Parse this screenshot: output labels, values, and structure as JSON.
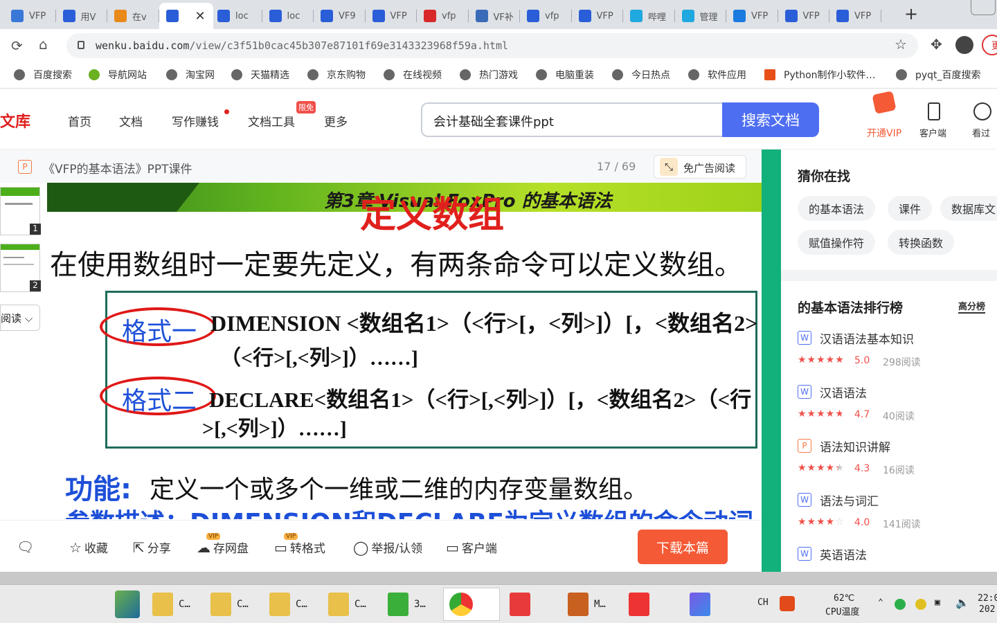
{
  "browser": {
    "tabs": [
      {
        "label": "VFP",
        "icon": "doc-icon",
        "color": "#3a78d8"
      },
      {
        "label": "用V",
        "icon": "baidu-paw-icon",
        "color": "#2a5ed8"
      },
      {
        "label": "在v",
        "icon": "chat-bubble-icon",
        "color": "#e88a1a"
      },
      {
        "label": "",
        "icon": "baidu-paw-icon",
        "color": "#2a5ed8",
        "active": true
      },
      {
        "label": "loc",
        "icon": "baidu-paw-icon",
        "color": "#2a5ed8"
      },
      {
        "label": "loc",
        "icon": "baidu-paw-icon",
        "color": "#2a5ed8"
      },
      {
        "label": "VF9",
        "icon": "baidu-paw-icon",
        "color": "#2a5ed8"
      },
      {
        "label": "VFP",
        "icon": "baidu-paw-icon",
        "color": "#2a5ed8"
      },
      {
        "label": "vfp",
        "icon": "red-v-icon",
        "color": "#d8282a"
      },
      {
        "label": "VF补",
        "icon": "tool-icon",
        "color": "#3a6ab8"
      },
      {
        "label": "vfp",
        "icon": "baidu-paw-icon",
        "color": "#2a5ed8"
      },
      {
        "label": "VFP",
        "icon": "baidu-paw-icon",
        "color": "#2a5ed8"
      },
      {
        "label": "哔哩",
        "icon": "bilibili-icon",
        "color": "#20a8e0"
      },
      {
        "label": "管理",
        "icon": "bilibili-icon",
        "color": "#20a8e0"
      },
      {
        "label": "VFP",
        "icon": "person-icon",
        "color": "#1a7ae0"
      },
      {
        "label": "VFP",
        "icon": "baidu-paw-icon",
        "color": "#2a5ed8"
      },
      {
        "label": "VFP",
        "icon": "baidu-paw-icon",
        "color": "#2a5ed8"
      }
    ],
    "url_host": "wenku.baidu.com",
    "url_path": "/view/c3f51b0cac45b307e87101f69e3143323968f59a.html",
    "profile_label": "更"
  },
  "bookmarks": [
    {
      "label": "百度搜索"
    },
    {
      "label": "导航网站"
    },
    {
      "label": "淘宝网"
    },
    {
      "label": "天猫精选"
    },
    {
      "label": "京东购物"
    },
    {
      "label": "在线视频"
    },
    {
      "label": "热门游戏"
    },
    {
      "label": "电脑重装"
    },
    {
      "label": "今日热点"
    },
    {
      "label": "软件应用"
    },
    {
      "label": "Python制作小软件…"
    },
    {
      "label": "pyqt_百度搜索"
    }
  ],
  "site": {
    "logo": "文库",
    "nav": [
      "首页",
      "文档",
      "写作赚钱",
      "文档工具",
      "更多"
    ],
    "nav_badge": "限免",
    "search_value": "会计基础全套课件ppt",
    "search_button": "搜索文档",
    "actions": [
      "开通VIP",
      "客户端",
      "看过"
    ]
  },
  "document": {
    "type_badge": "P",
    "title": "《VFP的基本语法》PPT课件",
    "page_indicator": "17 / 69",
    "ad_free_label": "免广告阅读",
    "thumbs": [
      "1",
      "2"
    ],
    "read_mode": "阅读"
  },
  "slide": {
    "banner_title": "第3章 Visual FoxPro 的基本语法",
    "heading": "定义数组",
    "intro": "在使用数组时一定要先定义，有两条命令可以定义数组。",
    "format1_label": "格式一",
    "format1_line1": "DIMENSION <数组名1>（<行>[，<列>]）[，<数组名2>",
    "format1_line2": "（<行>[,<列>]）……]",
    "format2_label": "格式二",
    "format2_line1": "DECLARE<数组名1>（<行>[,<列>]）[，<数组名2>（<行",
    "format2_line2": ">[,<列>]）……]",
    "function_label": "功能:",
    "function_text": "定义一个或多个一维或二维的内存变量数组。",
    "params_partial": "参数描述：DIMENSION和DECLARE为定义数组的命令动词"
  },
  "sidebar": {
    "guess_title": "猜你在找",
    "chips": [
      "的基本语法",
      "课件",
      "数据库文",
      "赋值操作符",
      "转换函数"
    ],
    "rank_title": "的基本语法排行榜",
    "rank_tab": "高分榜",
    "items": [
      {
        "type": "W",
        "title": "汉语语法基本知识",
        "stars": 5,
        "score": "5.0",
        "reads": "298阅读"
      },
      {
        "type": "W",
        "title": "汉语语法",
        "stars": 4.7,
        "score": "4.7",
        "reads": "40阅读"
      },
      {
        "type": "P",
        "title": "语法知识讲解",
        "stars": 4.3,
        "score": "4.3",
        "reads": "16阅读"
      },
      {
        "type": "W",
        "title": "语法与词汇",
        "stars": 4,
        "score": "4.0",
        "reads": "141阅读"
      },
      {
        "type": "W",
        "title": "英语语法",
        "stars": 0,
        "score": "",
        "reads": ""
      }
    ]
  },
  "toolbar": {
    "collect": "收藏",
    "share": "分享",
    "save_pan": "存网盘",
    "convert": "转格式",
    "report": "举报/认领",
    "client": "客户端",
    "vip_tag": "VIP",
    "download": "下载本篇"
  },
  "taskbar": {
    "items": [
      "C…",
      "C…",
      "C…",
      "C…",
      "3…",
      "",
      "",
      "M…",
      "",
      ""
    ],
    "ime": "CH",
    "cpu_temp": "62℃",
    "cpu_label": "CPU温度",
    "time": "22:0",
    "date": "202"
  },
  "colors": {
    "accent_blue": "#4e6ef2",
    "download_red": "#f45a36",
    "slide_green": "#12b07a",
    "star_red": "#f0504a"
  }
}
